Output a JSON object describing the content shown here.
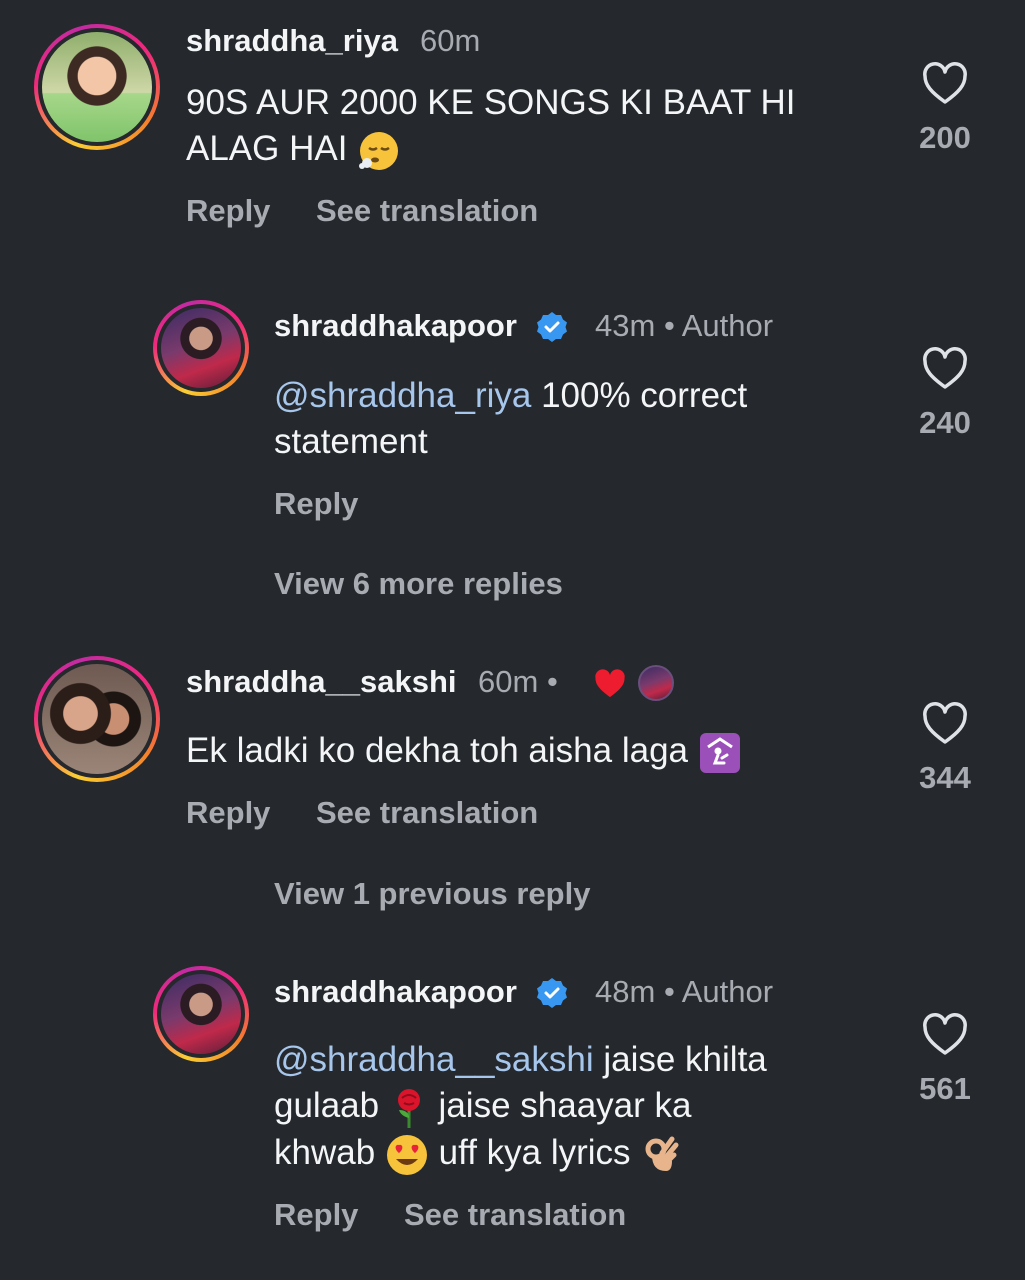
{
  "comments": [
    {
      "username": "shraddha_riya",
      "time": "60m",
      "text_line1": "90S AUR 2000 KE SONGS KI BAAT HI",
      "text_line2": "ALAG HAI",
      "reply": "Reply",
      "see_translation": "See translation",
      "likes": "200",
      "icons": [
        "heart-outline-icon",
        "sighing-face-emoji"
      ]
    },
    {
      "username": "shraddhakapoor",
      "time": "43m",
      "separator": "•",
      "author_label": "Author",
      "mention": "@shraddha_riya",
      "text_rest": " 100% correct",
      "text_line2": "statement",
      "reply": "Reply",
      "likes": "240",
      "icons": [
        "verified-badge-icon",
        "heart-outline-icon"
      ]
    },
    {
      "view_more": "View 6 more replies"
    },
    {
      "username": "shraddha__sakshi",
      "time": "60m",
      "separator": "•",
      "text": "Ek ladki ko dekha toh aisha laga ",
      "reply": "Reply",
      "see_translation": "See translation",
      "likes": "344",
      "icons": [
        "red-heart-icon",
        "author-avatar-mini",
        "person-kneeling-emoji",
        "heart-outline-icon"
      ]
    },
    {
      "view_more": "View 1 previous reply"
    },
    {
      "username": "shraddhakapoor",
      "time": "48m",
      "separator": "•",
      "author_label": "Author",
      "mention": "@shraddha__sakshi",
      "text_rest": " jaise khilta",
      "text_line2a": "gulaab ",
      "text_line2b": " jaise shaayar ka",
      "text_line3a": "khwab ",
      "text_line3b": " uff kya lyrics ",
      "reply": "Reply",
      "see_translation": "See translation",
      "likes": "561",
      "icons": [
        "verified-badge-icon",
        "rose-emoji",
        "heart-eyes-emoji",
        "ok-hand-emoji",
        "heart-outline-icon"
      ]
    }
  ],
  "colors": {
    "background": "#25282c",
    "text": "#f3f5f7",
    "muted": "#a8acb2",
    "mention": "#a7c6ec",
    "verified": "#3897f0"
  }
}
